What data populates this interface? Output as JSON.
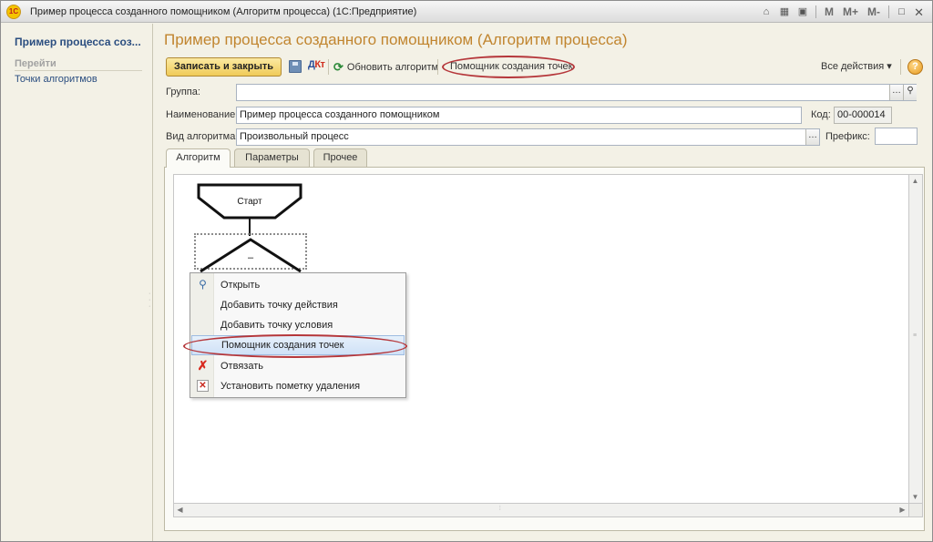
{
  "window": {
    "title": "Пример процесса созданного помощником (Алгоритм процесса)  (1С:Предприятие)",
    "logo_text": "1С",
    "tools": [
      "M",
      "M+",
      "M-"
    ]
  },
  "left_panel": {
    "title": "Пример процесса соз...",
    "goto_header": "Перейти",
    "links": [
      "Точки алгоритмов"
    ]
  },
  "form": {
    "title": "Пример процесса созданного помощником (Алгоритм процесса)",
    "toolbar": {
      "save_close": "Записать и закрыть",
      "dtkt_left": "Д",
      "dtkt_right": "Кт",
      "refresh": "Обновить алгоритм",
      "wizard": "Помощник создания точек",
      "all_actions": "Все действия ▾",
      "help": "?"
    },
    "fields": {
      "group_label": "Группа:",
      "group_value": "",
      "name_label": "Наименование:",
      "name_value": "Пример процесса созданного помощником",
      "code_label": "Код:",
      "code_value": "00-000014",
      "kind_label": "Вид алгоритма:",
      "kind_value": "Произвольный процесс",
      "prefix_label": "Префикс:",
      "prefix_value": ""
    },
    "tabs": [
      "Алгоритм",
      "Параметры",
      "Прочее"
    ],
    "diagram": {
      "start_label": "Старт",
      "condition_label": "–"
    }
  },
  "context_menu": {
    "items": [
      {
        "label": "Открыть",
        "icon": "search-icon"
      },
      {
        "label": "Добавить точку действия",
        "icon": ""
      },
      {
        "label": "Добавить точку условия",
        "icon": ""
      },
      {
        "label": "Помощник создания точек",
        "icon": ""
      },
      {
        "label": "Отвязать",
        "icon": "unlink-x-icon"
      },
      {
        "label": "Установить пометку удаления",
        "icon": "delete-mark-icon"
      }
    ],
    "highlighted_index": 3
  },
  "colors": {
    "title_orange": "#c1852f",
    "link_blue": "#2b4e80",
    "annotation_red": "#b5363a",
    "primary_button": "#f0cb58"
  }
}
